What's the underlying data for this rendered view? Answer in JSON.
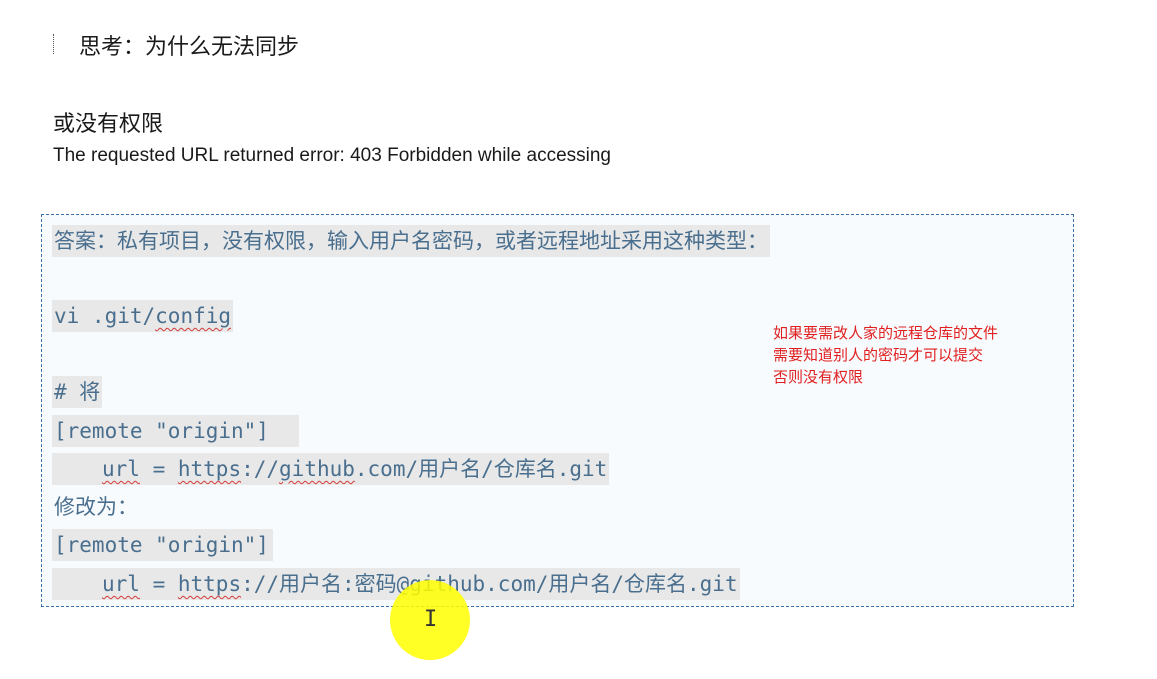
{
  "heading": {
    "think": "思考：为什么无法同步",
    "permission": "或没有权限",
    "error": "The requested URL returned error: 403 Forbidden while accessing"
  },
  "answer": {
    "intro": "答案：私有项目，没有权限，输入用户名密码，或者远程地址采用这种类型：",
    "cmd_vi": "vi .git/",
    "cmd_config": "config",
    "comment": "# 将",
    "remote1": "[remote \"origin\"]",
    "url1_key": "url",
    "url1_eq": " = ",
    "url1_https": "https",
    "url1_mid": "://",
    "url1_github": "github",
    "url1_rest": ".com/用户名/仓库名.git",
    "modify": "修改为：",
    "remote2": "[remote \"origin\"]",
    "url2_key": "url",
    "url2_eq": " = ",
    "url2_https": "https",
    "url2_rest": "://用户名:密码@github.com/用户名/仓库名.git"
  },
  "note": {
    "line1": "如果要需改人家的远程仓库的文件",
    "line2": "需要知道别人的密码才可以提交",
    "line3": "否则没有权限"
  },
  "colors": {
    "code_text": "#4a6f8e",
    "code_bg": "#e8e8e8",
    "note_red": "#e02020",
    "cursor_highlight": "#ffff00",
    "box_border": "#3b6fa8"
  }
}
